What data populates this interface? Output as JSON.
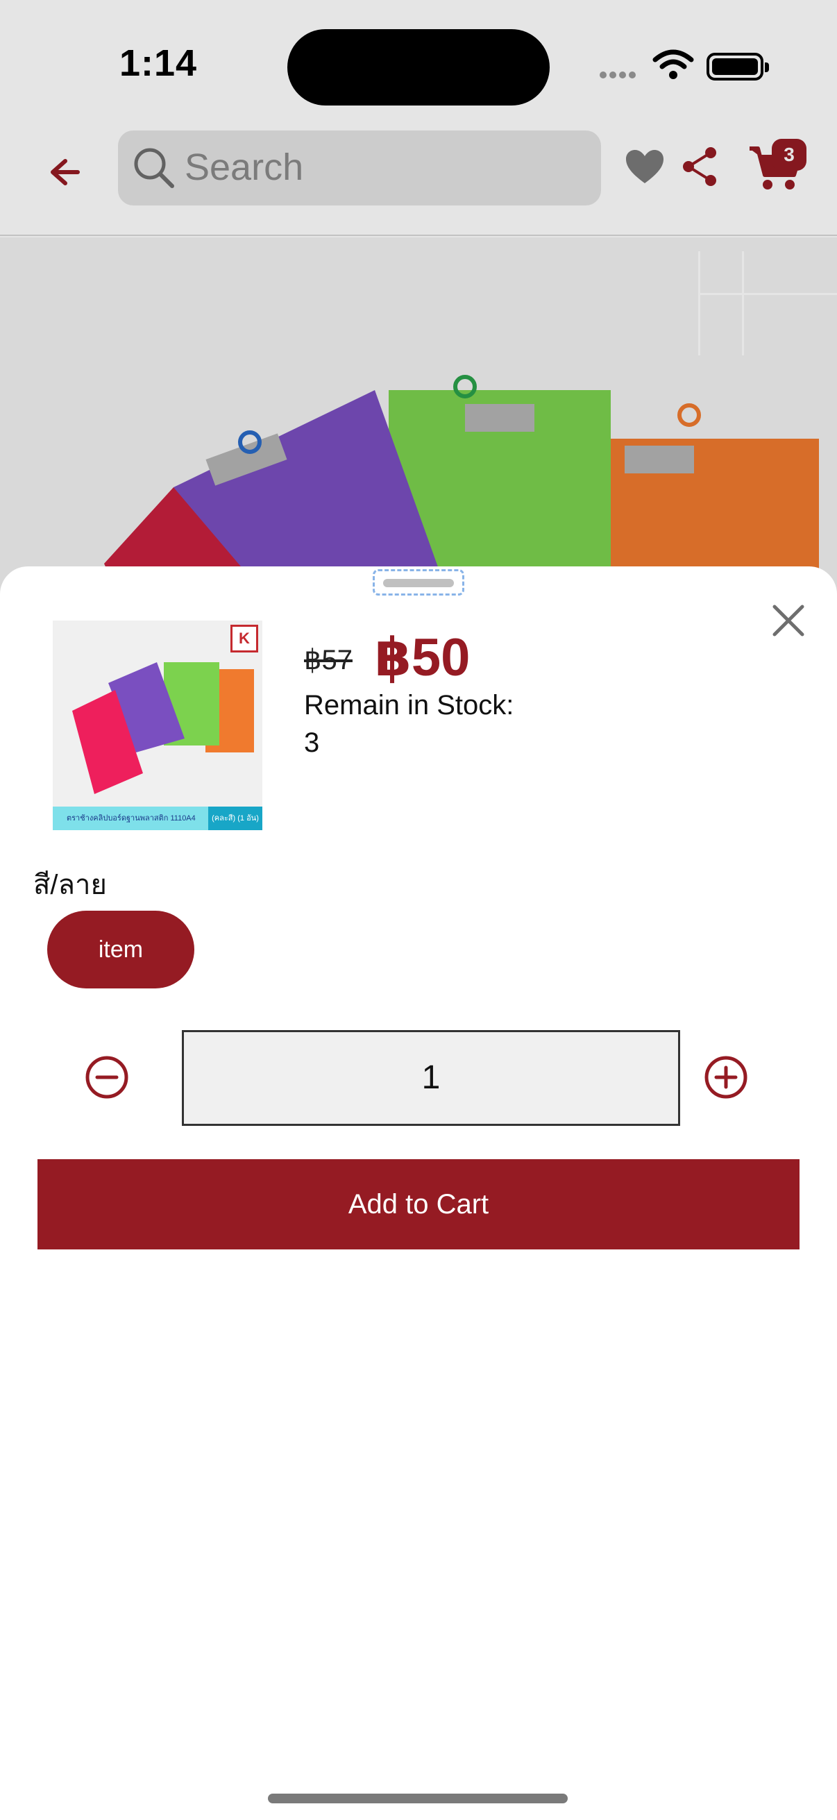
{
  "status_bar": {
    "time": "1:14",
    "icons": [
      "signal-icon",
      "wifi-icon",
      "battery-icon"
    ]
  },
  "nav": {
    "back_icon": "arrow-left-icon",
    "search_placeholder": "Search",
    "search_icon": "search-icon",
    "actions": [
      "heart-icon",
      "share-icon",
      "cart-icon"
    ],
    "cart_count": "3"
  },
  "hero": {
    "board_colors": [
      "#c8203e",
      "#7a4fc0",
      "#7cd24e",
      "#f07a2e"
    ]
  },
  "sheet": {
    "close_icon": "close-icon",
    "thumbnail": {
      "caption": "ตราช้างคลิปบอร์ดฐานพลาสติก 1110A4",
      "caption_tag": "(คละสี) (1 อัน)",
      "logo": "K"
    },
    "price_original": "฿57",
    "price_current": "฿50",
    "stock_label": "Remain in Stock:",
    "stock_value": "3",
    "option_group_title": "สี/ลาย",
    "options": [
      {
        "label": "item",
        "selected": true
      }
    ],
    "quantity": "1",
    "add_to_cart_label": "Add to Cart"
  },
  "colors": {
    "accent": "#951b23",
    "search_bg": "#e4e4e4",
    "qty_bg": "#f0f0f0"
  }
}
